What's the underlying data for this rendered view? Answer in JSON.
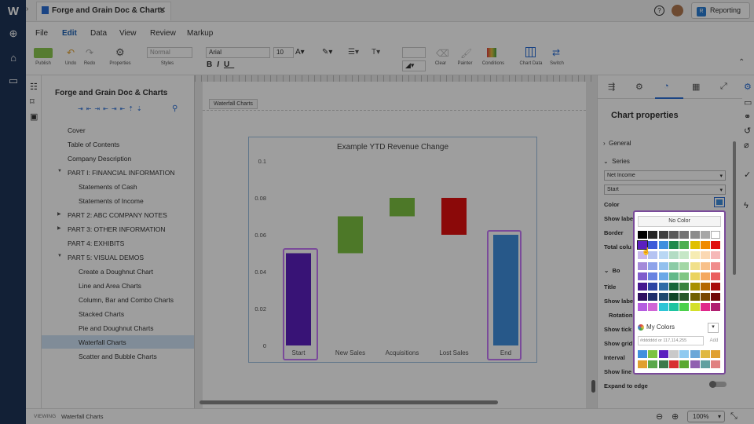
{
  "app": {
    "tab_title": "Forge and Grain Doc & Charts",
    "reporting_label": "Reporting",
    "reporting_badge": "R"
  },
  "menu": [
    "File",
    "Edit",
    "Data",
    "View",
    "Review",
    "Markup"
  ],
  "toolbar": {
    "publish": "Publish",
    "undo": "Undo",
    "redo": "Redo",
    "properties": "Properties",
    "style_value": "Normal",
    "styles": "Styles",
    "font": "Arial",
    "size": "10",
    "clear": "Clear",
    "painter": "Painter",
    "conditions": "Conditions",
    "chart_data": "Chart Data",
    "switch": "Switch"
  },
  "outline": {
    "title": "Forge and Grain Doc & Charts",
    "items": [
      {
        "label": "Cover",
        "level": 1
      },
      {
        "label": "Table of Contents",
        "level": 1
      },
      {
        "label": "Company Description",
        "level": 1
      },
      {
        "label": "PART I: FINANCIAL INFORMATION",
        "level": 1,
        "toggle": "▼"
      },
      {
        "label": "Statements of Cash",
        "level": 2
      },
      {
        "label": "Statements of Income",
        "level": 2
      },
      {
        "label": "PART 2: ABC COMPANY NOTES",
        "level": 1,
        "toggle": "▶"
      },
      {
        "label": "PART 3: OTHER INFORMATION",
        "level": 1,
        "toggle": "▶"
      },
      {
        "label": "PART 4: EXHIBITS",
        "level": 1
      },
      {
        "label": "PART 5: VISUAL DEMOS",
        "level": 1,
        "toggle": "▼"
      },
      {
        "label": "Create a Doughnut Chart",
        "level": 2
      },
      {
        "label": "Line and Area Charts",
        "level": 2
      },
      {
        "label": "Column, Bar and Combo Charts",
        "level": 2
      },
      {
        "label": "Stacked Charts",
        "level": 2
      },
      {
        "label": "Pie and Doughnut Charts",
        "level": 2
      },
      {
        "label": "Waterfall Charts",
        "level": 2,
        "selected": true
      },
      {
        "label": "Scatter and Bubble Charts",
        "level": 2
      }
    ]
  },
  "canvas": {
    "section_tab": "Waterfall Charts"
  },
  "chart_data": {
    "type": "bar",
    "title": "Example YTD Revenue Change",
    "categories": [
      "Start",
      "New Sales",
      "Acquisitions",
      "Lost Sales",
      "End"
    ],
    "bars": [
      {
        "low": 0,
        "high": 0.05,
        "color": "#5b1fbf"
      },
      {
        "low": 0.05,
        "high": 0.07,
        "color": "#7dc242"
      },
      {
        "low": 0.07,
        "high": 0.08,
        "color": "#7dc242"
      },
      {
        "low": 0.06,
        "high": 0.08,
        "color": "#e01010"
      },
      {
        "low": 0,
        "high": 0.06,
        "color": "#3f8fde"
      }
    ],
    "ylim": [
      0,
      0.1
    ],
    "yticks": [
      "0",
      "0.02",
      "0.04",
      "0.06",
      "0.08",
      "0.1"
    ],
    "grid": false
  },
  "panel": {
    "title": "Chart properties",
    "general": "General",
    "series": "Series",
    "series_select": "Net Income",
    "point_select": "Start",
    "labels": [
      "Color",
      "Show labe",
      "Border",
      "Total colu",
      "Bo",
      "Title",
      "Show labe",
      "Rotation",
      "Show tick",
      "Show grid",
      "Interval",
      "Show line",
      "Expand to edge"
    ]
  },
  "picker": {
    "no_color": "No Color",
    "my_colors": "My Colors",
    "hex_placeholder": "#dddddd or 117,114,255",
    "add": "Add",
    "grid": [
      [
        "#000000",
        "#262626",
        "#404040",
        "#595959",
        "#737373",
        "#8c8c8c",
        "#a6a6a6",
        "#ffffff"
      ],
      [
        "#5b1fbf",
        "#3b5bd9",
        "#3f8fde",
        "#1f8a4c",
        "#4caf50",
        "#e0c000",
        "#f08a00",
        "#e01010"
      ],
      [
        "#c9b8ec",
        "#b5c3f2",
        "#b9d7f4",
        "#b3dcc4",
        "#c6e7c7",
        "#f6ecb3",
        "#fbd8b3",
        "#f6b8b8"
      ],
      [
        "#a48ad9",
        "#8ea3ea",
        "#93c0ee",
        "#8ccba6",
        "#a3d7a5",
        "#f1e08a",
        "#f8c08a",
        "#f08c8c"
      ],
      [
        "#7f5ccc",
        "#6883e1",
        "#6ba8e7",
        "#62b889",
        "#80c683",
        "#ead35f",
        "#f4a85f",
        "#ea6060"
      ],
      [
        "#44178f",
        "#2c44a3",
        "#2f6ba7",
        "#176739",
        "#39833c",
        "#a89000",
        "#b46700",
        "#a80c0c"
      ],
      [
        "#2e0f60",
        "#1e2e6c",
        "#1f486f",
        "#0f4526",
        "#265728",
        "#706000",
        "#784500",
        "#700808"
      ],
      [
        "#b55ce0",
        "#d065d6",
        "#2ec5d6",
        "#1ec4a0",
        "#4bd14b",
        "#d4e02a",
        "#e0288a",
        "#b02070"
      ]
    ],
    "my_row1": [
      "#3f8fde",
      "#7dc242",
      "#5b1fbf",
      "#c9c9c9",
      "#8fc9f0",
      "#6aa7d8",
      "#e0b840",
      "#e0a030"
    ],
    "my_row2": [
      "#e0a030",
      "#5aa84a",
      "#3d7a4a",
      "#d83030",
      "#5aa830",
      "#9060b0",
      "#60a0a0",
      "#e08080"
    ]
  },
  "status": {
    "mode": "VIEWING",
    "location": "Waterfall Charts",
    "zoom": "100%"
  }
}
